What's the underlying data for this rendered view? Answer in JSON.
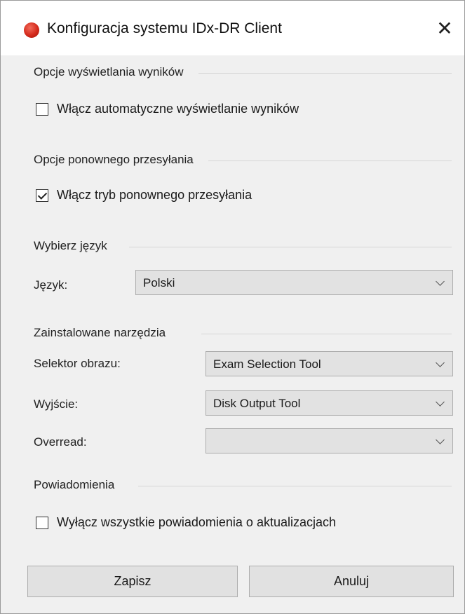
{
  "window": {
    "title": "Konfiguracja systemu IDx-DR Client",
    "close_glyph": "✕"
  },
  "results_display": {
    "heading": "Opcje wyświetlania wyników",
    "auto_display": {
      "label": "Włącz automatyczne wyświetlanie wyników",
      "checked": false
    }
  },
  "resend": {
    "heading": "Opcje ponownego przesyłania",
    "resend_mode": {
      "label": "Włącz tryb ponownego przesyłania",
      "checked": true
    }
  },
  "language": {
    "heading": "Wybierz język",
    "field_label": "Język:",
    "selected": "Polski"
  },
  "tools": {
    "heading": "Zainstalowane narzędzia",
    "image_selector": {
      "label": "Selektor obrazu:",
      "value": "Exam Selection Tool"
    },
    "output": {
      "label": "Wyjście:",
      "value": "Disk Output Tool"
    },
    "overread": {
      "label": "Overread:",
      "value": ""
    }
  },
  "notifications": {
    "heading": "Powiadomienia",
    "disable_updates": {
      "label": "Wyłącz wszystkie powiadomienia o aktualizacjach",
      "checked": false
    }
  },
  "buttons": {
    "save": "Zapisz",
    "cancel": "Anuluj"
  }
}
